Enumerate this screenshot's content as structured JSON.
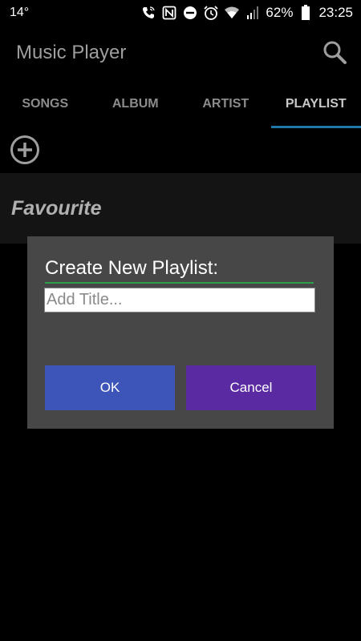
{
  "status_bar": {
    "temperature": "14°",
    "battery_percent": "62%",
    "time": "23:25",
    "icons": [
      "call-wifi-icon",
      "nfc-icon",
      "do-not-disturb-icon",
      "alarm-icon",
      "wifi-icon",
      "signal-icon",
      "battery-icon"
    ]
  },
  "app_bar": {
    "title": "Music Player",
    "search_icon": "search-icon"
  },
  "tabs": [
    {
      "label": "SONGS",
      "active": false
    },
    {
      "label": "ALBUM",
      "active": false
    },
    {
      "label": "ARTIST",
      "active": false
    },
    {
      "label": "PLAYLIST",
      "active": true
    }
  ],
  "add_button_icon": "add-circle-icon",
  "playlists": [
    {
      "name": "Favourite"
    }
  ],
  "dialog": {
    "title": "Create New Playlist:",
    "input_value": "",
    "input_placeholder": "Add Title...",
    "ok_label": "OK",
    "cancel_label": "Cancel"
  },
  "colors": {
    "tab_indicator": "#1f77a8",
    "ok_button": "#3d55b8",
    "cancel_button": "#5a2aa3",
    "dialog_bg": "#474747",
    "divider": "#2e9e4a"
  }
}
